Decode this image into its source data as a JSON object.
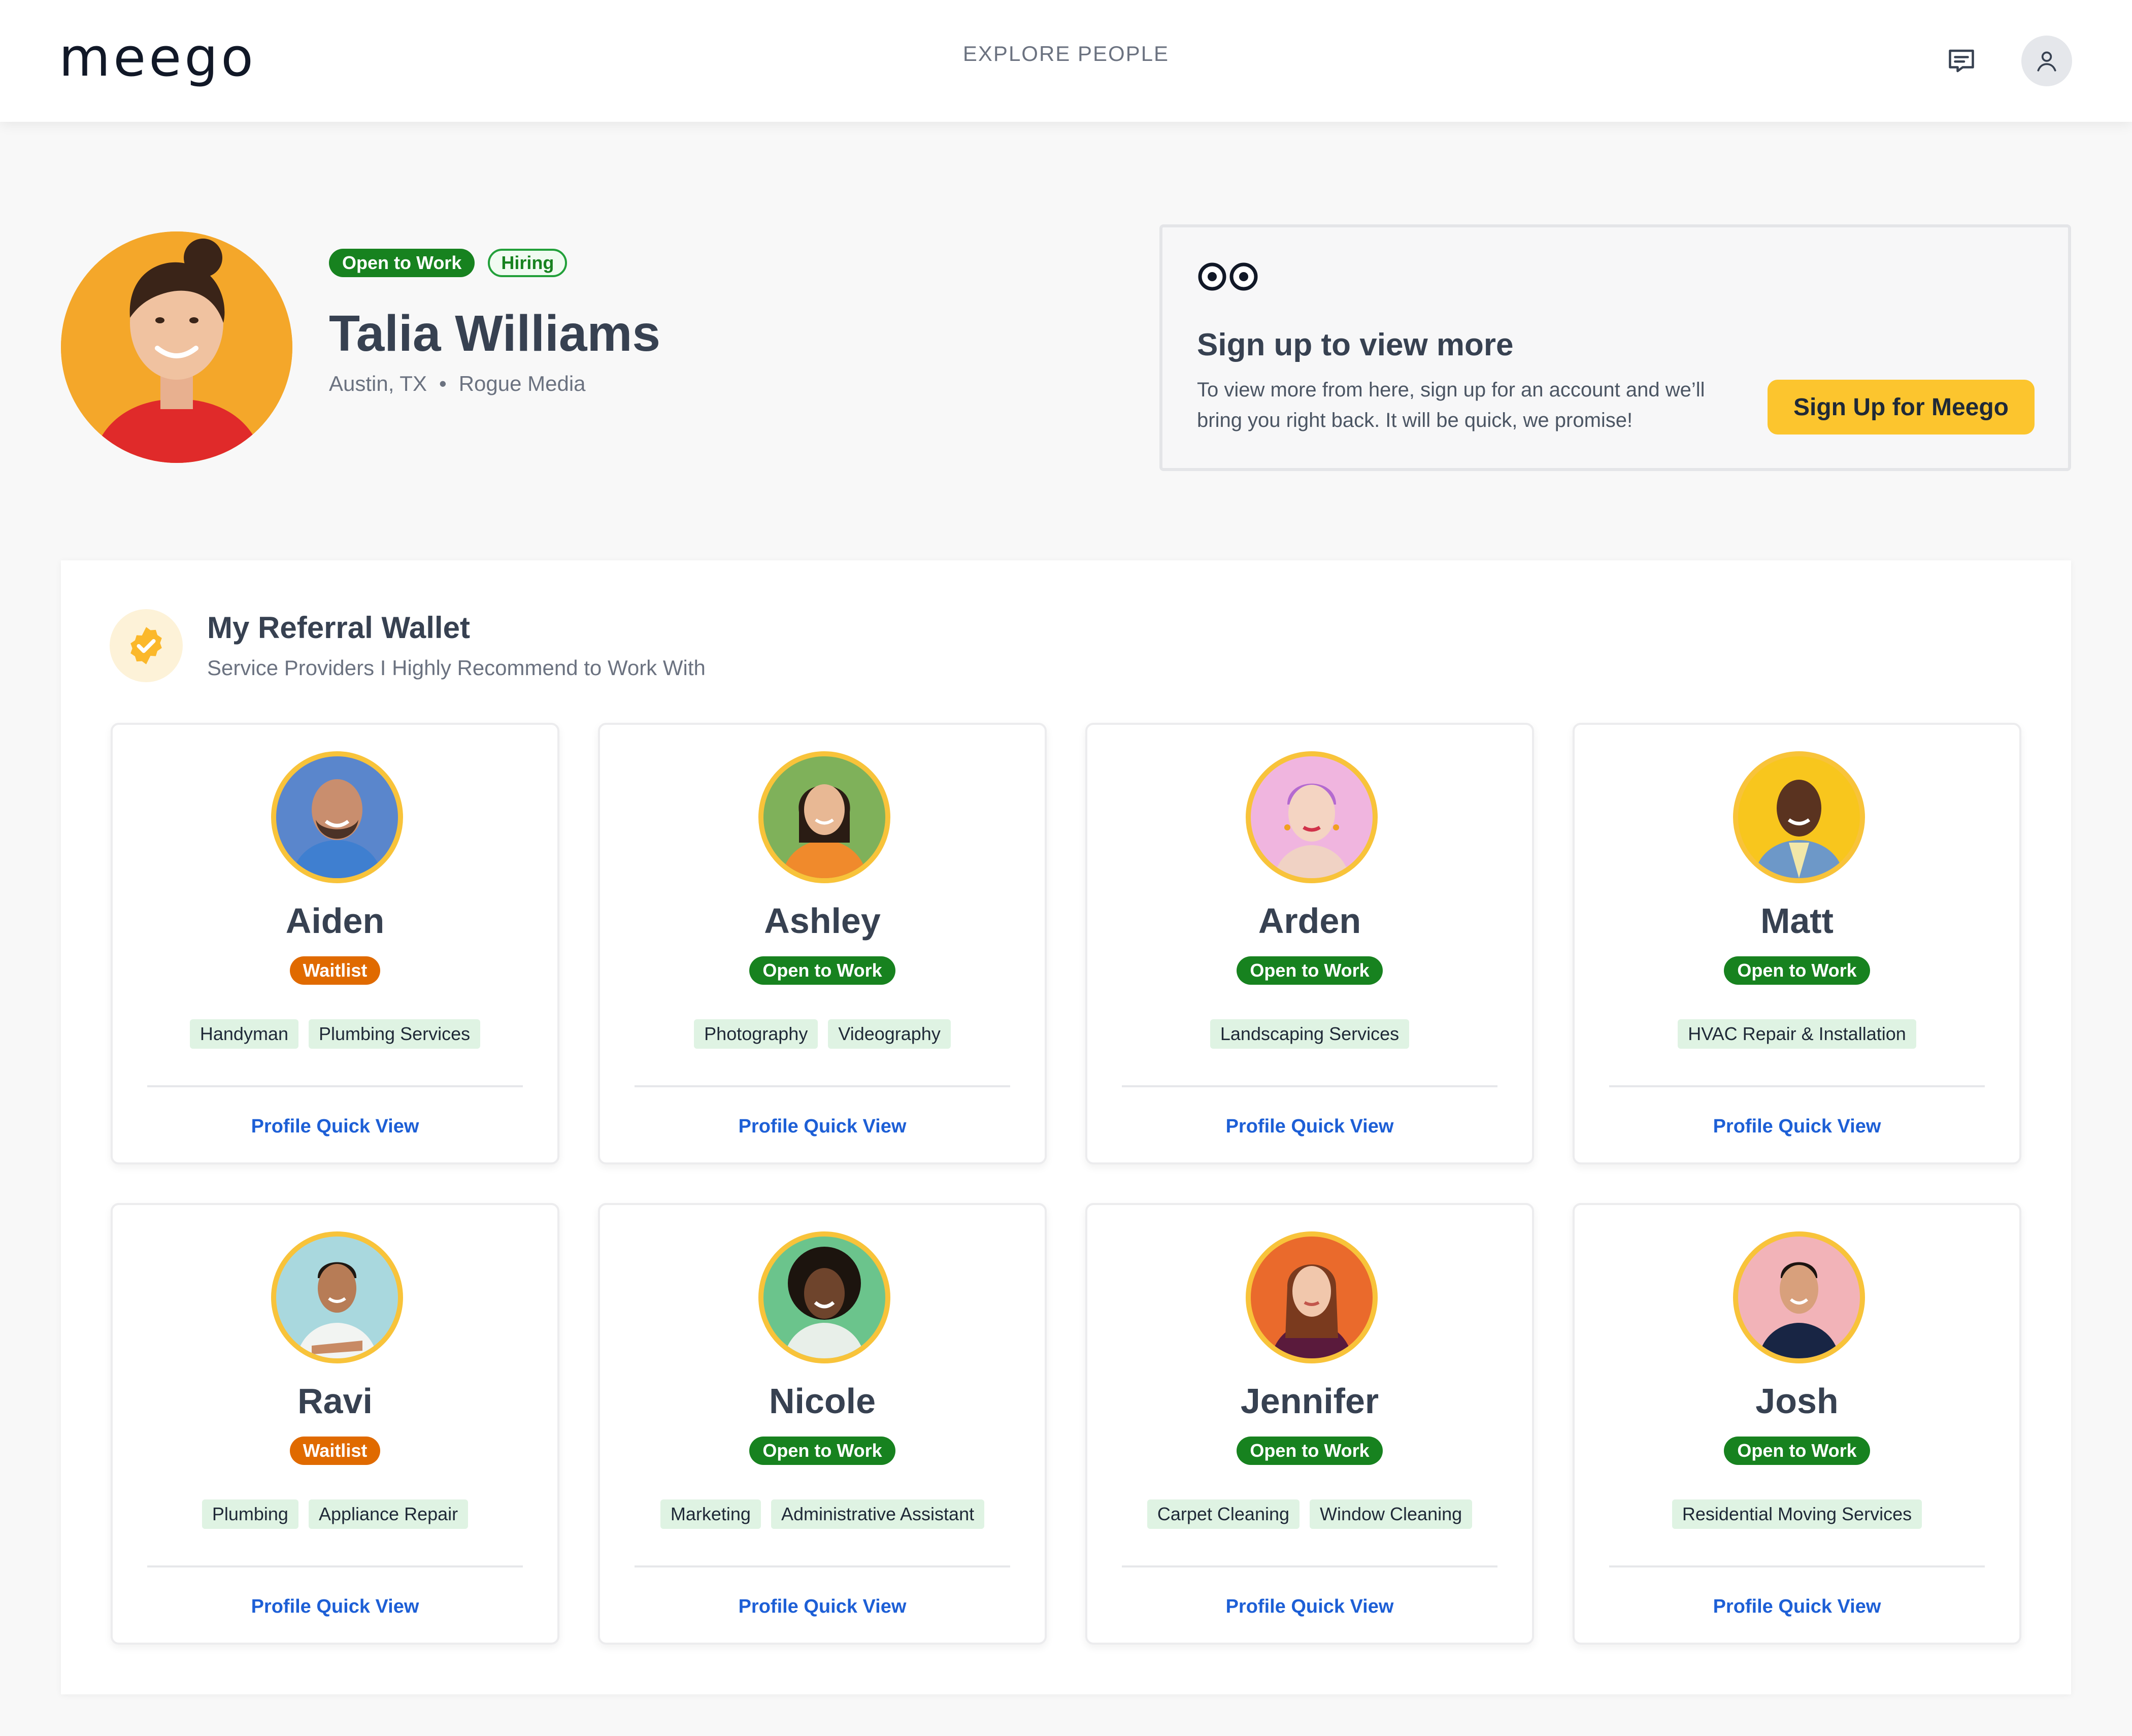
{
  "header": {
    "logo": "meego",
    "nav_label": "EXPLORE PEOPLE"
  },
  "profile": {
    "badges": [
      "Open to Work",
      "Hiring"
    ],
    "name": "Talia Williams",
    "location": "Austin, TX",
    "separator": "•",
    "company": "Rogue Media"
  },
  "signup": {
    "title": "Sign up to view more",
    "description": "To view more from here, sign up for an account and we’ll bring you right back. It will be quick, we promise!",
    "button_label": "Sign Up for Meego"
  },
  "wallet": {
    "title": "My Referral Wallet",
    "subtitle": "Service Providers I Highly Recommend to Work With",
    "link_label": "Profile Quick View",
    "providers": [
      {
        "name": "Aiden",
        "status": "Waitlist",
        "tags": [
          "Handyman",
          "Plumbing Services"
        ]
      },
      {
        "name": "Ashley",
        "status": "Open to Work",
        "tags": [
          "Photography",
          "Videography"
        ]
      },
      {
        "name": "Arden",
        "status": "Open to Work",
        "tags": [
          "Landscaping Services"
        ]
      },
      {
        "name": "Matt",
        "status": "Open to Work",
        "tags": [
          "HVAC Repair & Installation"
        ]
      },
      {
        "name": "Ravi",
        "status": "Waitlist",
        "tags": [
          "Plumbing",
          "Appliance Repair"
        ]
      },
      {
        "name": "Nicole",
        "status": "Open to Work",
        "tags": [
          "Marketing",
          "Administrative Assistant"
        ]
      },
      {
        "name": "Jennifer",
        "status": "Open to Work",
        "tags": [
          "Carpet Cleaning",
          "Window Cleaning"
        ]
      },
      {
        "name": "Josh",
        "status": "Open to Work",
        "tags": [
          "Residential Moving Services"
        ]
      }
    ]
  },
  "colors": {
    "brand_yellow": "#fcc52e",
    "status_green": "#17821f",
    "status_orange": "#e06a00",
    "link_blue": "#1d5fd6",
    "tag_bg": "#dff3e3"
  },
  "icons": [
    "chat-icon",
    "user-icon",
    "eyes-icon",
    "verified-badge-icon"
  ]
}
